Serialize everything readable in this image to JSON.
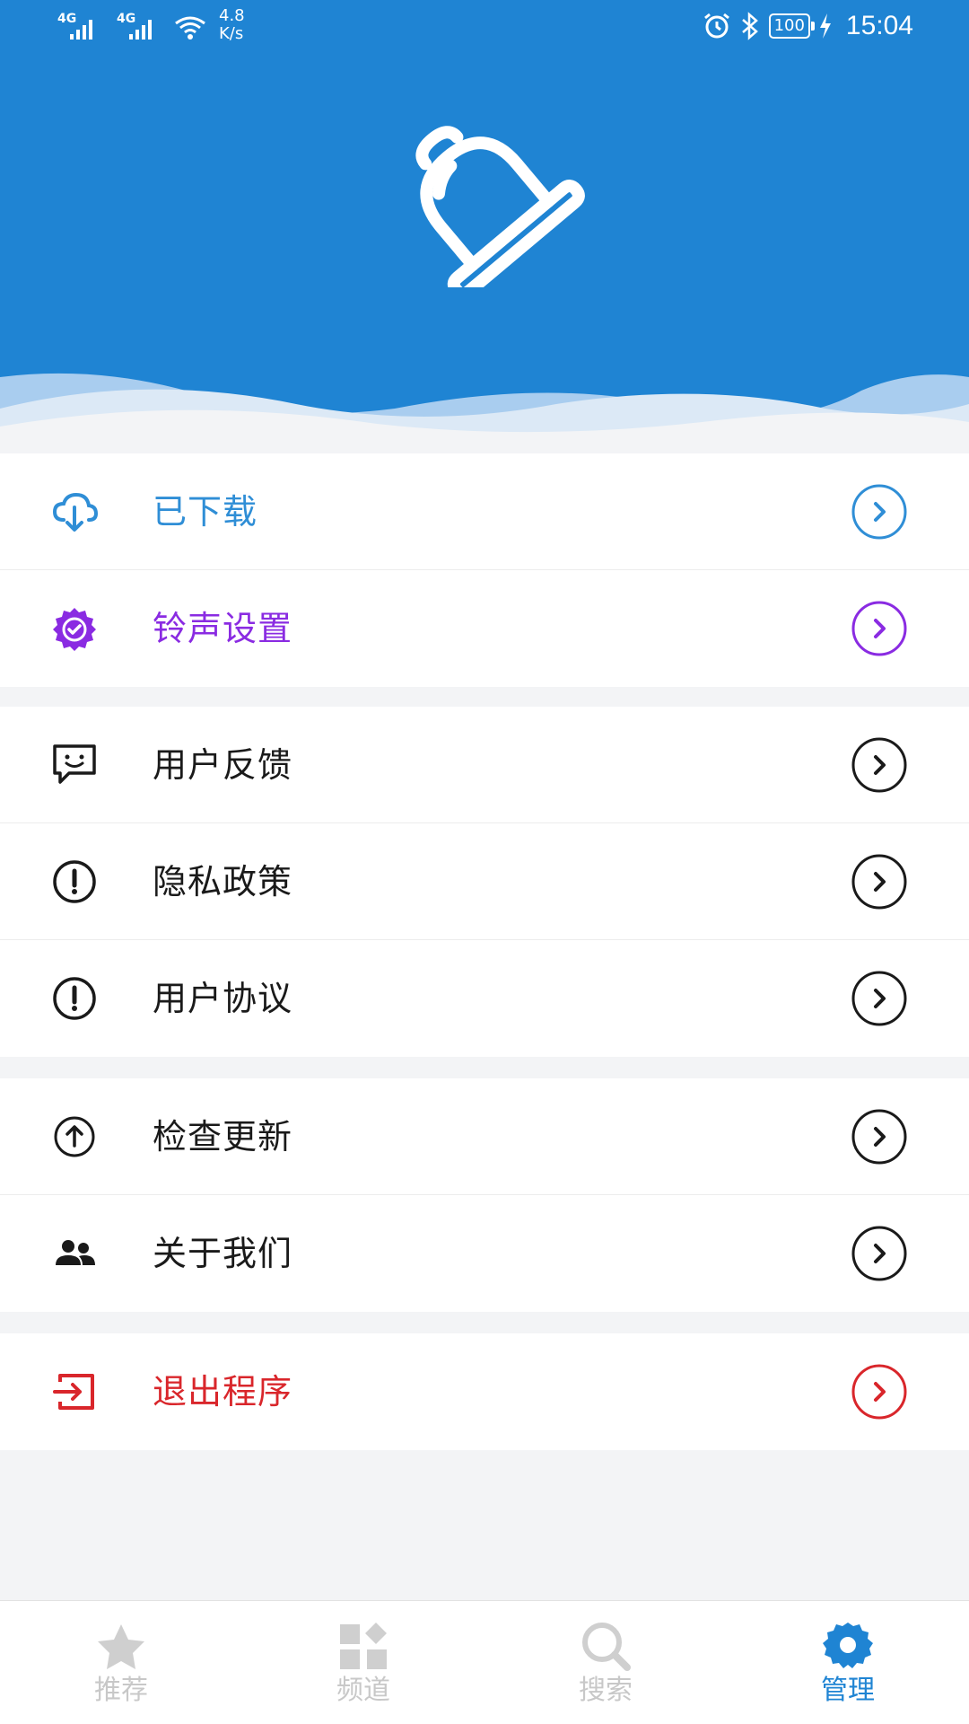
{
  "status_bar": {
    "net1": "4G",
    "net2": "4G",
    "speed_value": "4.8",
    "speed_unit": "K/s",
    "battery": "100",
    "time": "15:04"
  },
  "theme": {
    "primary": "#1f84d3",
    "downloaded_color": "#2f8ed6",
    "ringtone_color": "#8a2be2",
    "exit_color": "#d9262b",
    "default_color": "#1a1a1a"
  },
  "menu": {
    "downloaded": {
      "label": "已下载",
      "icon": "cloud-download-icon"
    },
    "ringtone_settings": {
      "label": "铃声设置",
      "icon": "badge-check-icon"
    },
    "feedback": {
      "label": "用户反馈",
      "icon": "chat-smile-icon"
    },
    "privacy": {
      "label": "隐私政策",
      "icon": "alert-circle-icon"
    },
    "agreement": {
      "label": "用户协议",
      "icon": "alert-circle-icon"
    },
    "check_update": {
      "label": "检查更新",
      "icon": "upload-circle-icon"
    },
    "about": {
      "label": "关于我们",
      "icon": "users-icon"
    },
    "exit": {
      "label": "退出程序",
      "icon": "exit-icon"
    }
  },
  "bottom_nav": {
    "items": [
      {
        "label": "推荐",
        "icon": "star-icon",
        "active": false
      },
      {
        "label": "频道",
        "icon": "grid-icon",
        "active": false
      },
      {
        "label": "搜索",
        "icon": "search-icon",
        "active": false
      },
      {
        "label": "管理",
        "icon": "gear-icon",
        "active": true
      }
    ]
  }
}
